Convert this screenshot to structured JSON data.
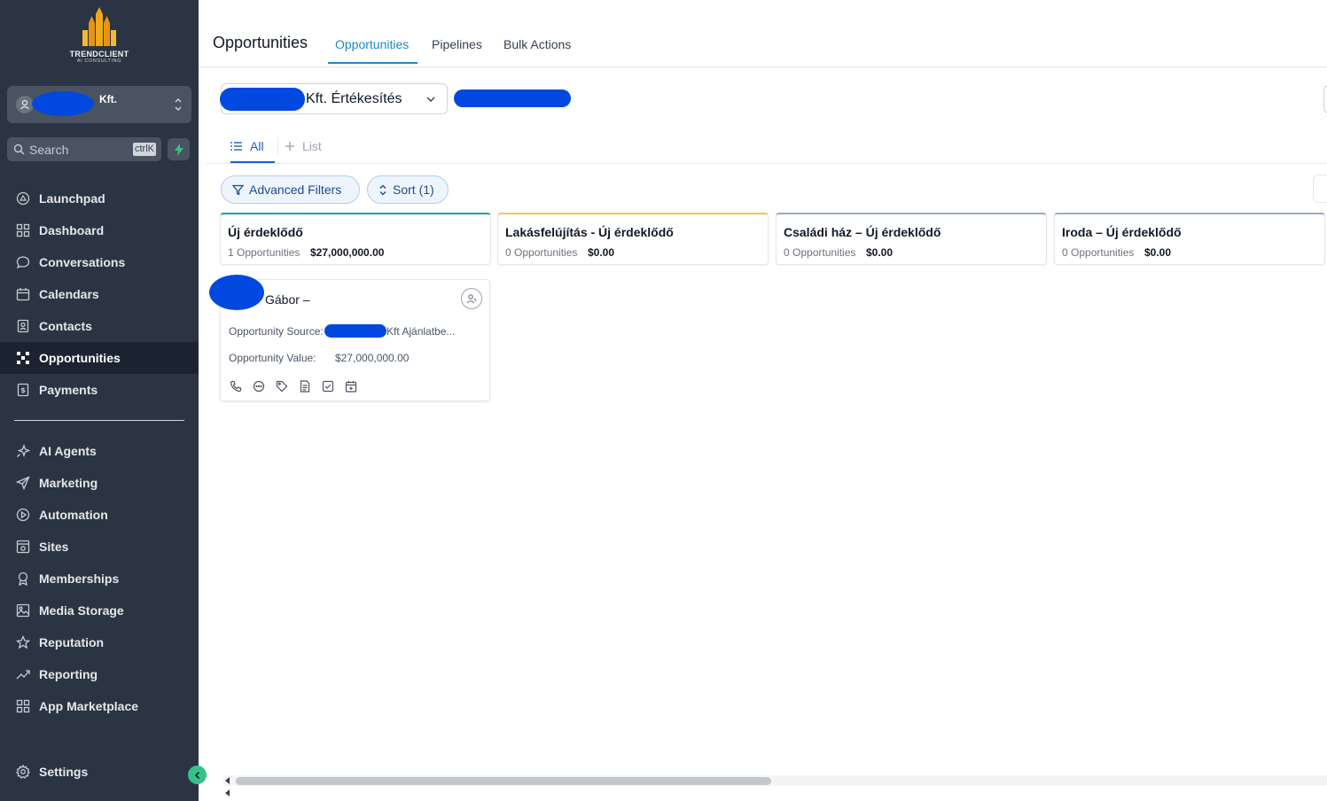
{
  "brand": {
    "name": "TRENDCLIENT",
    "tagline": "AI CONSULTING"
  },
  "account": {
    "name": "Kft."
  },
  "search": {
    "placeholder": "Search",
    "shortcut": "ctrlK"
  },
  "sidebar": {
    "items": [
      {
        "label": "Launchpad",
        "icon": "launchpad-icon"
      },
      {
        "label": "Dashboard",
        "icon": "dashboard-icon"
      },
      {
        "label": "Conversations",
        "icon": "chat-icon"
      },
      {
        "label": "Calendars",
        "icon": "calendar-icon"
      },
      {
        "label": "Contacts",
        "icon": "contacts-icon"
      },
      {
        "label": "Opportunities",
        "icon": "opportunities-icon",
        "active": true
      },
      {
        "label": "Payments",
        "icon": "payments-icon"
      }
    ],
    "items2": [
      {
        "label": "AI Agents",
        "icon": "sparkle-icon"
      },
      {
        "label": "Marketing",
        "icon": "send-icon"
      },
      {
        "label": "Automation",
        "icon": "automation-icon"
      },
      {
        "label": "Sites",
        "icon": "sites-icon"
      },
      {
        "label": "Memberships",
        "icon": "award-icon"
      },
      {
        "label": "Media Storage",
        "icon": "image-icon"
      },
      {
        "label": "Reputation",
        "icon": "star-icon"
      },
      {
        "label": "Reporting",
        "icon": "trend-icon"
      },
      {
        "label": "App Marketplace",
        "icon": "apps-icon"
      }
    ],
    "settings": "Settings"
  },
  "header": {
    "title": "Opportunities",
    "tabs": [
      "Opportunities",
      "Pipelines",
      "Bulk Actions"
    ]
  },
  "pipeline": {
    "selected": "Kft. Értékesítés"
  },
  "views": {
    "all": "All",
    "add_list": "List"
  },
  "filters": {
    "advanced": "Advanced Filters",
    "sort": "Sort (1)"
  },
  "stages": [
    {
      "title": "Új érdeklődő",
      "count": "1 Opportunities",
      "value": "$27,000,000.00",
      "color": "#17a2b8"
    },
    {
      "title": "Lakásfelújítás - Új érdeklődő",
      "count": "0 Opportunities",
      "value": "$0.00",
      "color": "#f5c542"
    },
    {
      "title": "Családi ház – Új érdeklődő",
      "count": "0 Opportunities",
      "value": "$0.00",
      "color": "#9aa8c7"
    },
    {
      "title": "Iroda – Új érdeklődő",
      "count": "0 Opportunities",
      "value": "$0.00",
      "color": "#9aa8c7"
    }
  ],
  "card": {
    "name": "Gábor –",
    "source_label": "Opportunity Source:",
    "source_value": "Kft Ajánlatbe...",
    "value_label": "Opportunity Value:",
    "value": "$27,000,000.00"
  }
}
